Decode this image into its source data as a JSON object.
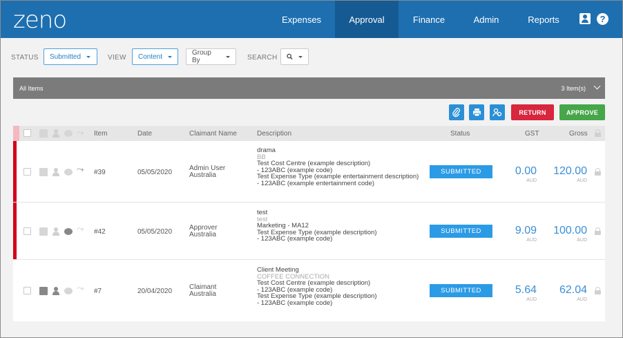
{
  "app": {
    "logo": "zeno"
  },
  "nav": [
    {
      "label": "Expenses",
      "active": false
    },
    {
      "label": "Approval",
      "active": true
    },
    {
      "label": "Finance",
      "active": false
    },
    {
      "label": "Admin",
      "active": false
    },
    {
      "label": "Reports",
      "active": false
    }
  ],
  "top_icons": [
    "user-icon",
    "help-icon"
  ],
  "help_glyph": "?",
  "filters": {
    "status_label": "STATUS",
    "status_value": "Submitted",
    "view_label": "VIEW",
    "view_value": "Content",
    "group_by": "Group By",
    "search_label": "SEARCH"
  },
  "all_items": {
    "label": "All Items",
    "count": "3 Item(s)"
  },
  "actions": {
    "attach_icon": "paperclip-icon",
    "print_icon": "printer-icon",
    "assign_icon": "user-group-icon",
    "return_label": "RETURN",
    "approve_label": "APPROVE"
  },
  "columns": {
    "item": "Item",
    "date": "Date",
    "claimant": "Claimant Name",
    "description": "Description",
    "status": "Status",
    "gst": "GST",
    "gross": "Gross"
  },
  "rows": [
    {
      "item": "#39",
      "date": "05/05/2020",
      "claimant_1": "Admin User",
      "claimant_2": "Australia",
      "desc": [
        "drama",
        "BB",
        "Test Cost Centre (example description)",
        "- 123ABC (example code)",
        "Test Expense Type (example entertainment description)",
        "- 123ABC (example entertainment code)"
      ],
      "status": "SUBMITTED",
      "gst": "0.00",
      "gst_cur": "AUD",
      "gross": "120.00",
      "gross_cur": "AUD",
      "flagged": true
    },
    {
      "item": "#42",
      "date": "05/05/2020",
      "claimant_1": "Approver",
      "claimant_2": "Australia",
      "desc": [
        "test",
        "test",
        "Marketing - MA12",
        "Test Expense Type (example description)",
        "- 123ABC (example code)"
      ],
      "status": "SUBMITTED",
      "gst": "9.09",
      "gst_cur": "AUD",
      "gross": "100.00",
      "gross_cur": "AUD",
      "flagged": true
    },
    {
      "item": "#7",
      "date": "20/04/2020",
      "claimant_1": "Claimant",
      "claimant_2": "Australia",
      "desc": [
        "Client Meeting",
        "COFFEE CONNECTION",
        "Test Cost Centre (example description)",
        "- 123ABC (example code)",
        "Test Expense Type (example description)",
        "- 123ABC (example code)"
      ],
      "status": "SUBMITTED",
      "gst": "5.64",
      "gst_cur": "AUD",
      "gross": "62.04",
      "gross_cur": "AUD",
      "flagged": false
    }
  ],
  "colors": {
    "brand": "#1d6fb0",
    "accent_blue": "#2b9be6",
    "return_red": "#d7263d",
    "approve_green": "#47a64a",
    "flag_red": "#d0021b"
  }
}
